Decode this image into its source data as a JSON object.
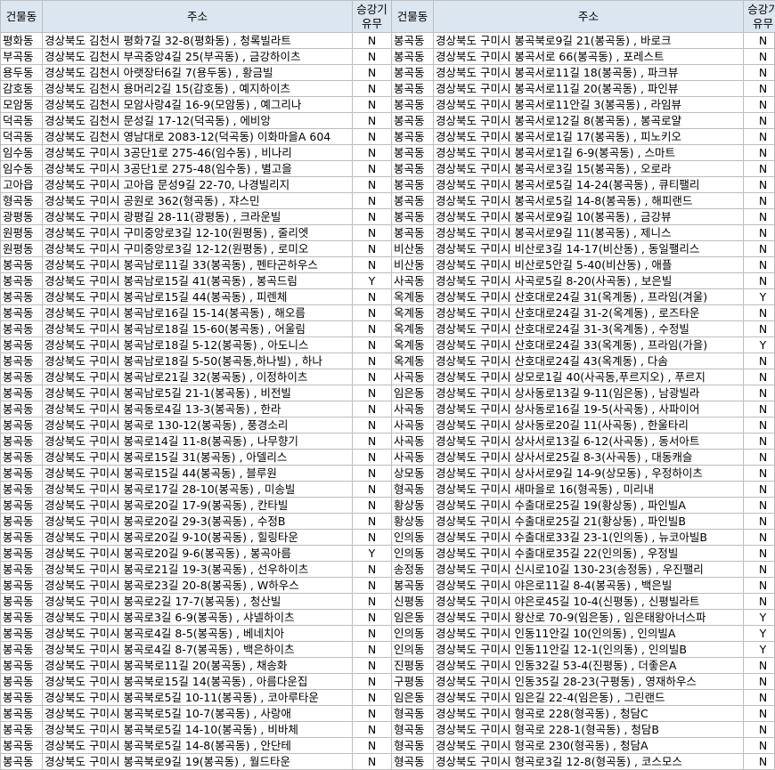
{
  "headers": {
    "building": "건물동",
    "address": "주소",
    "elevator_line1": "승강기",
    "elevator_line2": "유무"
  },
  "rows": [
    {
      "l_dong": "평화동",
      "l_addr": "경상북도 김천시 평화7길 32-8(평화동) , 청록빌라트",
      "l_el": "N",
      "r_dong": "봉곡동",
      "r_addr": "경상북도 구미시 봉곡북로9길 21(봉곡동) , 바로크",
      "r_el": "N"
    },
    {
      "l_dong": "부곡동",
      "l_addr": "경상북도 김천시 부곡중앙4길 25(부곡동) , 금강하이츠",
      "l_el": "N",
      "r_dong": "봉곡동",
      "r_addr": "경상북도 구미시 봉곡서로 66(봉곡동) , 포레스트",
      "r_el": "N"
    },
    {
      "l_dong": "용두동",
      "l_addr": "경상북도 김천시 아랫장터6길 7(용두동) , 황금빌",
      "l_el": "N",
      "r_dong": "봉곡동",
      "r_addr": "경상북도 구미시 봉곡서로11길 18(봉곡동) , 파크뷰",
      "r_el": "N"
    },
    {
      "l_dong": "감호동",
      "l_addr": "경상북도 김천시 용머리2길 15(감호동) , 예지하이츠",
      "l_el": "N",
      "r_dong": "봉곡동",
      "r_addr": "경상북도 구미시 봉곡서로11길 20(봉곡동) , 파인뷰",
      "r_el": "N"
    },
    {
      "l_dong": "모암동",
      "l_addr": "경상북도 김천시 모암사랑4길 16-9(모암동) , 예그리나",
      "l_el": "N",
      "r_dong": "봉곡동",
      "r_addr": "경상북도 구미시 봉곡서로11안길 3(봉곡동) , 라임뷰",
      "r_el": "N"
    },
    {
      "l_dong": "덕곡동",
      "l_addr": "경상북도 김천시 문성길 17-12(덕곡동) , 에비앙",
      "l_el": "N",
      "r_dong": "봉곡동",
      "r_addr": "경상북도 구미시 봉곡서로12길 8(봉곡동) , 봉곡로얄",
      "r_el": "N"
    },
    {
      "l_dong": "덕곡동",
      "l_addr": "경상북도 김천시 영남대로 2083-12(덕곡동) 이화마을A 604",
      "l_el": "N",
      "r_dong": "봉곡동",
      "r_addr": "경상북도 구미시 봉곡서로1길 17(봉곡동) , 피노키오",
      "r_el": "N"
    },
    {
      "l_dong": "임수동",
      "l_addr": "경상북도 구미시 3공단1로 275-46(임수동) , 비나리",
      "l_el": "N",
      "r_dong": "봉곡동",
      "r_addr": "경상북도 구미시 봉곡서로1길 6-9(봉곡동) , 스마트",
      "r_el": "N"
    },
    {
      "l_dong": "임수동",
      "l_addr": "경상북도 구미시 3공단1로 275-48(임수동) , 별고을",
      "l_el": "N",
      "r_dong": "봉곡동",
      "r_addr": "경상북도 구미시 봉곡서로3길 15(봉곡동) , 오로라",
      "r_el": "N"
    },
    {
      "l_dong": "고아읍",
      "l_addr": "경상북도 구미시 고아읍 문성9길 22-70, 나경빌리지",
      "l_el": "N",
      "r_dong": "봉곡동",
      "r_addr": "경상북도 구미시 봉곡서로5길 14-24(봉곡동) , 큐티팰리",
      "r_el": "N"
    },
    {
      "l_dong": "형곡동",
      "l_addr": "경상북도 구미시 공원로 362(형곡동) , 쟈스민",
      "l_el": "N",
      "r_dong": "봉곡동",
      "r_addr": "경상북도 구미시 봉곡서로5길 14-8(봉곡동) , 해피랜드",
      "r_el": "N"
    },
    {
      "l_dong": "광평동",
      "l_addr": "경상북도 구미시 광평길 28-11(광평동) , 크라운빌",
      "l_el": "N",
      "r_dong": "봉곡동",
      "r_addr": "경상북도 구미시 봉곡서로9길 10(봉곡동) , 금강뷰",
      "r_el": "N"
    },
    {
      "l_dong": "원평동",
      "l_addr": "경상북도 구미시 구미중앙로3길 12-10(원평동) , 줄리엣",
      "l_el": "N",
      "r_dong": "봉곡동",
      "r_addr": "경상북도 구미시 봉곡서로9길 11(봉곡동) , 제니스",
      "r_el": "N"
    },
    {
      "l_dong": "원평동",
      "l_addr": "경상북도 구미시 구미중앙로3길 12-12(원평동) , 로미오",
      "l_el": "N",
      "r_dong": "비산동",
      "r_addr": "경상북도 구미시 비산로3길 14-17(비산동) , 동일팰리스",
      "r_el": "N"
    },
    {
      "l_dong": "봉곡동",
      "l_addr": "경상북도 구미시 봉곡남로11길 33(봉곡동) , 펜타곤하우스",
      "l_el": "N",
      "r_dong": "비산동",
      "r_addr": "경상북도 구미시 비산로5안길 5-40(비산동) , 애플",
      "r_el": "N"
    },
    {
      "l_dong": "봉곡동",
      "l_addr": "경상북도 구미시 봉곡남로15길 41(봉곡동) , 봉곡드림",
      "l_el": "Y",
      "r_dong": "사곡동",
      "r_addr": "경상북도 구미시 사곡로5길 8-20(사곡동) , 보은빌",
      "r_el": "N"
    },
    {
      "l_dong": "봉곡동",
      "l_addr": "경상북도 구미시 봉곡남로15길 44(봉곡동) , 피렌체",
      "l_el": "N",
      "r_dong": "옥계동",
      "r_addr": "경상북도 구미시 산호대로24길 31(옥계동) , 프라임(겨울)",
      "r_el": "Y"
    },
    {
      "l_dong": "봉곡동",
      "l_addr": "경상북도 구미시 봉곡남로16길 15-14(봉곡동) , 해오름",
      "l_el": "N",
      "r_dong": "옥계동",
      "r_addr": "경상북도 구미시 산호대로24길 31-2(옥계동) , 로즈타운",
      "r_el": "N"
    },
    {
      "l_dong": "봉곡동",
      "l_addr": "경상북도 구미시 봉곡남로18길 15-60(봉곡동) , 어울림",
      "l_el": "N",
      "r_dong": "옥계동",
      "r_addr": "경상북도 구미시 산호대로24길 31-3(옥계동) , 수정빌",
      "r_el": "N"
    },
    {
      "l_dong": "봉곡동",
      "l_addr": "경상북도 구미시 봉곡남로18길 5-12(봉곡동) , 아도니스",
      "l_el": "N",
      "r_dong": "옥계동",
      "r_addr": "경상북도 구미시 산호대로24길 33(옥계동) , 프라임(가을)",
      "r_el": "Y"
    },
    {
      "l_dong": "봉곡동",
      "l_addr": "경상북도 구미시 봉곡남로18길 5-50(봉곡동,하나빌) , 하나",
      "l_el": "N",
      "r_dong": "옥계동",
      "r_addr": "경상북도 구미시 산호대로24길 43(옥계동) , 다솜",
      "r_el": "N"
    },
    {
      "l_dong": "봉곡동",
      "l_addr": "경상북도 구미시 봉곡남로21길 32(봉곡동) , 이정하이츠",
      "l_el": "N",
      "r_dong": "사곡동",
      "r_addr": "경상북도 구미시 상모로1길 40(사곡동,푸르지오) , 푸르지",
      "r_el": "N"
    },
    {
      "l_dong": "봉곡동",
      "l_addr": "경상북도 구미시 봉곡남로5길 21-1(봉곡동) , 비전빌",
      "l_el": "N",
      "r_dong": "임은동",
      "r_addr": "경상북도 구미시 상사동로13길 9-11(임은동) , 남광빌라",
      "r_el": "N"
    },
    {
      "l_dong": "봉곡동",
      "l_addr": "경상북도 구미시 봉곡동로4길 13-3(봉곡동) , 한라",
      "l_el": "N",
      "r_dong": "사곡동",
      "r_addr": "경상북도 구미시 상사동로16길 19-5(사곡동) , 사파이어",
      "r_el": "N"
    },
    {
      "l_dong": "봉곡동",
      "l_addr": "경상북도 구미시 봉곡로 130-12(봉곡동) , 풍경소리",
      "l_el": "N",
      "r_dong": "사곡동",
      "r_addr": "경상북도 구미시 상사동로20길 11(사곡동) , 한울타리",
      "r_el": "N"
    },
    {
      "l_dong": "봉곡동",
      "l_addr": "경상북도 구미시 봉곡로14길 11-8(봉곡동) , 나무향기",
      "l_el": "N",
      "r_dong": "사곡동",
      "r_addr": "경상북도 구미시 상사서로13길 6-12(사곡동) , 동서아트",
      "r_el": "N"
    },
    {
      "l_dong": "봉곡동",
      "l_addr": "경상북도 구미시 봉곡로15길 31(봉곡동) , 아델리스",
      "l_el": "N",
      "r_dong": "사곡동",
      "r_addr": "경상북도 구미시 상사서로25길 8-3(사곡동) , 대동캐슬",
      "r_el": "N"
    },
    {
      "l_dong": "봉곡동",
      "l_addr": "경상북도 구미시 봉곡로15길 44(봉곡동) , 블루원",
      "l_el": "N",
      "r_dong": "상모동",
      "r_addr": "경상북도 구미시 상사서로9길 14-9(상모동) , 우정하이츠",
      "r_el": "N"
    },
    {
      "l_dong": "봉곡동",
      "l_addr": "경상북도 구미시 봉곡로17길 28-10(봉곡동) , 미송빌",
      "l_el": "N",
      "r_dong": "형곡동",
      "r_addr": "경상북도 구미시 새마을로 16(형곡동) , 미리내",
      "r_el": "N"
    },
    {
      "l_dong": "봉곡동",
      "l_addr": "경상북도 구미시 봉곡로20길 17-9(봉곡동) , 칸타빌",
      "l_el": "N",
      "r_dong": "황상동",
      "r_addr": "경상북도 구미시 수출대로25길 19(황상동) , 파인빌A",
      "r_el": "N"
    },
    {
      "l_dong": "봉곡동",
      "l_addr": "경상북도 구미시 봉곡로20길 29-3(봉곡동) , 수정B",
      "l_el": "N",
      "r_dong": "황상동",
      "r_addr": "경상북도 구미시 수출대로25길 21(황상동) , 파인빌B",
      "r_el": "N"
    },
    {
      "l_dong": "봉곡동",
      "l_addr": "경상북도 구미시 봉곡로20길 9-10(봉곡동) , 힐링타운",
      "l_el": "N",
      "r_dong": "인의동",
      "r_addr": "경상북도 구미시 수출대로33길 23-1(인의동) , 뉴코아빌B",
      "r_el": "N"
    },
    {
      "l_dong": "봉곡동",
      "l_addr": "경상북도 구미시 봉곡로20길 9-6(봉곡동) , 봉곡아름",
      "l_el": "Y",
      "r_dong": "인의동",
      "r_addr": "경상북도 구미시 수출대로35길 22(인의동) , 우정빌",
      "r_el": "N"
    },
    {
      "l_dong": "봉곡동",
      "l_addr": "경상북도 구미시 봉곡로21길 19-3(봉곡동) , 선우하이츠",
      "l_el": "N",
      "r_dong": "송정동",
      "r_addr": "경상북도 구미시 신시로10길 130-23(송정동) , 우진팰리",
      "r_el": "N"
    },
    {
      "l_dong": "봉곡동",
      "l_addr": "경상북도 구미시 봉곡로23길 20-8(봉곡동) , W하우스",
      "l_el": "N",
      "r_dong": "봉곡동",
      "r_addr": "경상북도 구미시 야은로11길 8-4(봉곡동) , 백은빌",
      "r_el": "N"
    },
    {
      "l_dong": "봉곡동",
      "l_addr": "경상북도 구미시 봉곡로2길 17-7(봉곡동) , 청산빌",
      "l_el": "N",
      "r_dong": "신평동",
      "r_addr": "경상북도 구미시 야은로45길 10-4(신평동) , 신평빌라트",
      "r_el": "N"
    },
    {
      "l_dong": "봉곡동",
      "l_addr": "경상북도 구미시 봉곡로3길 6-9(봉곡동) , 샤넬하이츠",
      "l_el": "N",
      "r_dong": "임은동",
      "r_addr": "경상북도 구미시 왕산로 70-9(임은동) , 임은태왕아너스파",
      "r_el": "Y"
    },
    {
      "l_dong": "봉곡동",
      "l_addr": "경상북도 구미시 봉곡로4길 8-5(봉곡동) , 베네치아",
      "l_el": "N",
      "r_dong": "인의동",
      "r_addr": "경상북도 구미시 인동11안길 10(인의동) , 인의빌A",
      "r_el": "Y"
    },
    {
      "l_dong": "봉곡동",
      "l_addr": "경상북도 구미시 봉곡로4길 8-7(봉곡동) , 백은하이츠",
      "l_el": "N",
      "r_dong": "인의동",
      "r_addr": "경상북도 구미시 인동11안길 12-1(인의동) , 인의빌B",
      "r_el": "Y"
    },
    {
      "l_dong": "봉곡동",
      "l_addr": "경상북도 구미시 봉곡북로11길 20(봉곡동) , 채송화",
      "l_el": "N",
      "r_dong": "진평동",
      "r_addr": "경상북도 구미시 인동32길 53-4(진평동) , 더좋은A",
      "r_el": "N"
    },
    {
      "l_dong": "봉곡동",
      "l_addr": "경상북도 구미시 봉곡북로15길 14(봉곡동) , 아름다운집",
      "l_el": "N",
      "r_dong": "구평동",
      "r_addr": "경상북도 구미시 인동35길 28-23(구평동) , 영재하우스",
      "r_el": "N"
    },
    {
      "l_dong": "봉곡동",
      "l_addr": "경상북도 구미시 봉곡북로5길 10-11(봉곡동) , 코아루타운",
      "l_el": "N",
      "r_dong": "임은동",
      "r_addr": "경상북도 구미시 임은길 22-4(임은동) , 그린랜드",
      "r_el": "N"
    },
    {
      "l_dong": "봉곡동",
      "l_addr": "경상북도 구미시 봉곡북로5길 10-7(봉곡동) , 사랑애",
      "l_el": "N",
      "r_dong": "형곡동",
      "r_addr": "경상북도 구미시 형곡로 228(형곡동) , 청담C",
      "r_el": "N"
    },
    {
      "l_dong": "봉곡동",
      "l_addr": "경상북도 구미시 봉곡북로5길 14-10(봉곡동) , 비바체",
      "l_el": "N",
      "r_dong": "형곡동",
      "r_addr": "경상북도 구미시 형곡로 228-1(형곡동) , 청담B",
      "r_el": "N"
    },
    {
      "l_dong": "봉곡동",
      "l_addr": "경상북도 구미시 봉곡북로5길 14-8(봉곡동) , 안단테",
      "l_el": "N",
      "r_dong": "형곡동",
      "r_addr": "경상북도 구미시 형곡로 230(형곡동) , 청담A",
      "r_el": "N"
    },
    {
      "l_dong": "봉곡동",
      "l_addr": "경상북도 구미시 봉곡북로9길 19(봉곡동) , 월드타운",
      "l_el": "N",
      "r_dong": "형곡동",
      "r_addr": "경상북도 구미시 형곡로3길 12-8(형곡동) , 코스모스",
      "r_el": "N"
    }
  ],
  "colors": {
    "header_bg": "#dce6f1",
    "grid_line": "#bdbdbd"
  }
}
